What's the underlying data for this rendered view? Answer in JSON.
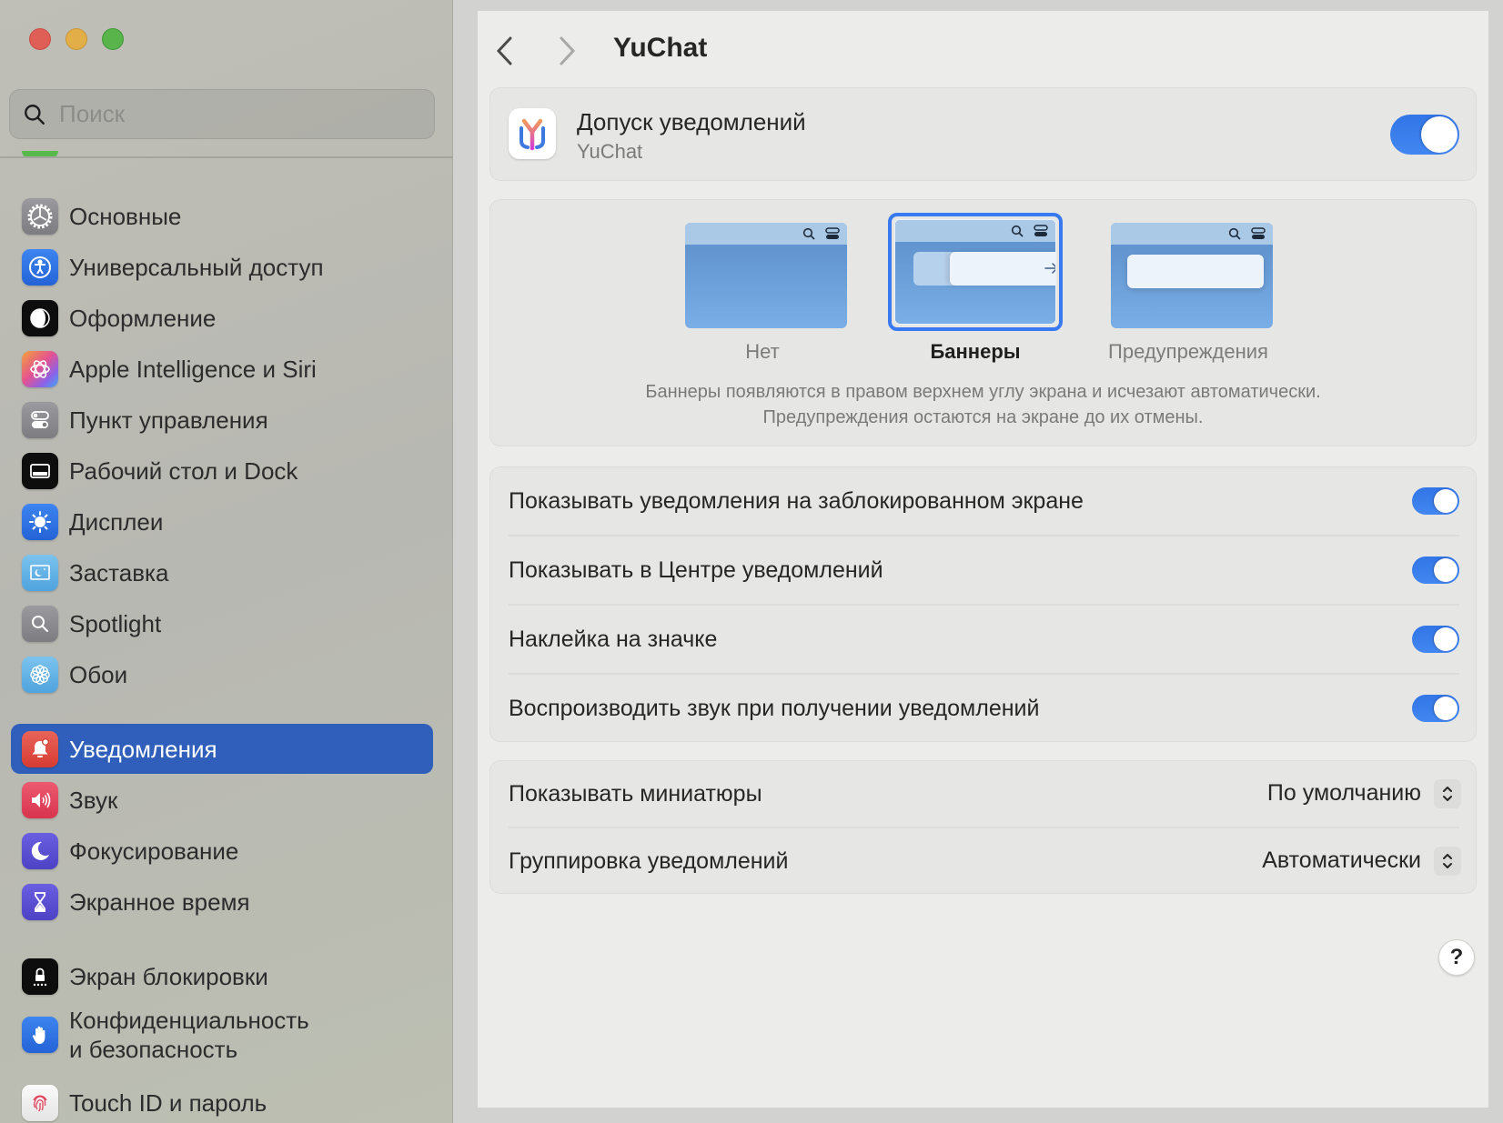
{
  "window": {
    "title": "YuChat",
    "traffic_lights": [
      "close",
      "minimize",
      "zoom"
    ]
  },
  "sidebar": {
    "search": {
      "placeholder": "Поиск",
      "value": ""
    },
    "items": [
      {
        "label": "Основные",
        "icon": "gear-icon",
        "color": "#8e8e93"
      },
      {
        "label": "Универсальный доступ",
        "icon": "accessibility-icon",
        "color": "#2f6fe0"
      },
      {
        "label": "Оформление",
        "icon": "appearance-icon",
        "color": "#111111"
      },
      {
        "label": "Apple Intelligence и Siri",
        "icon": "apple-intelligence-icon",
        "color": "#e0689a"
      },
      {
        "label": "Пункт управления",
        "icon": "control-center-icon",
        "color": "#8e8e93"
      },
      {
        "label": "Рабочий стол и Dock",
        "icon": "desktop-dock-icon",
        "color": "#111111"
      },
      {
        "label": "Дисплеи",
        "icon": "displays-icon",
        "color": "#2f6fe0"
      },
      {
        "label": "Заставка",
        "icon": "screensaver-icon",
        "color": "#5fb0e4"
      },
      {
        "label": "Spotlight",
        "icon": "spotlight-icon",
        "color": "#8e8e93"
      },
      {
        "label": "Обои",
        "icon": "wallpaper-icon",
        "color": "#5fb0e4"
      },
      {
        "label": "Уведомления",
        "icon": "notifications-icon",
        "color": "#e0463c",
        "selected": true
      },
      {
        "label": "Звук",
        "icon": "sound-icon",
        "color": "#e0405a"
      },
      {
        "label": "Фокусирование",
        "icon": "focus-icon",
        "color": "#5a4fcf"
      },
      {
        "label": "Экранное время",
        "icon": "screen-time-icon",
        "color": "#5a4fcf"
      },
      {
        "label": "Экран блокировки",
        "icon": "lock-screen-icon",
        "color": "#111111"
      },
      {
        "label": "Конфиденциальность\nи безопасность",
        "icon": "privacy-icon",
        "color": "#2f6fe0"
      },
      {
        "label": "Touch ID и пароль",
        "icon": "touch-id-icon",
        "color": "#f2f2f2"
      }
    ]
  },
  "main": {
    "title": "YuChat",
    "allow": {
      "title": "Допуск уведомлений",
      "subtitle": "YuChat",
      "enabled": true
    },
    "alert_style": {
      "options": [
        {
          "label": "Нет",
          "selected": false
        },
        {
          "label": "Баннеры",
          "selected": true
        },
        {
          "label": "Предупреждения",
          "selected": false
        }
      ],
      "description_line1": "Баннеры появляются в правом верхнем углу экрана и исчезают автоматически.",
      "description_line2": "Предупреждения остаются на экране до их отмены."
    },
    "toggles": [
      {
        "label": "Показывать уведомления на заблокированном экране",
        "enabled": true
      },
      {
        "label": "Показывать в Центре уведомлений",
        "enabled": true
      },
      {
        "label": "Наклейка на значке",
        "enabled": true
      },
      {
        "label": "Воспроизводить звук при получении уведомлений",
        "enabled": true
      }
    ],
    "selects": [
      {
        "label": "Показывать миниатюры",
        "value": "По умолчанию"
      },
      {
        "label": "Группировка уведомлений",
        "value": "Автоматически"
      }
    ],
    "help_label": "?"
  },
  "colors": {
    "accent": "#3275e6",
    "selection": "#2f5fba"
  }
}
